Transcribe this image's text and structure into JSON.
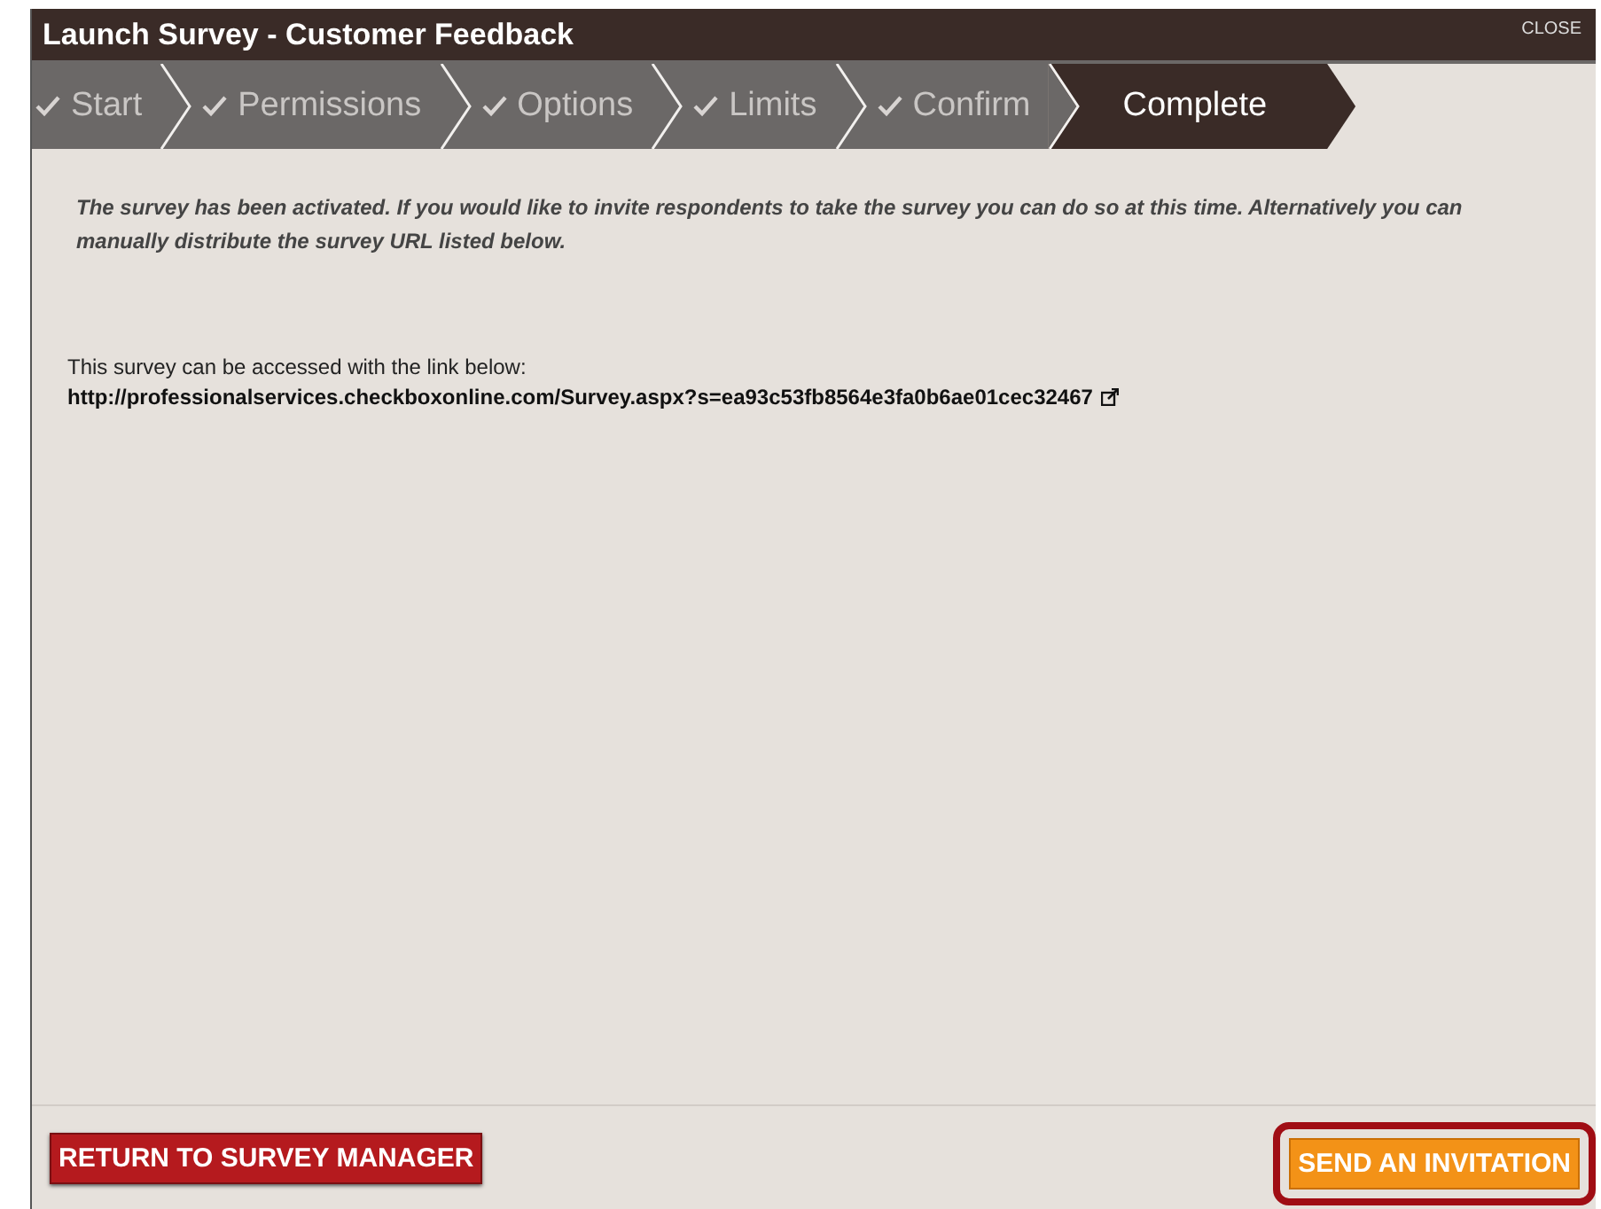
{
  "window": {
    "title": "Launch Survey - Customer Feedback",
    "close": "CLOSE"
  },
  "steps": [
    {
      "label": "Start",
      "completed": true,
      "selected": false
    },
    {
      "label": "Permissions",
      "completed": true,
      "selected": false
    },
    {
      "label": "Options",
      "completed": true,
      "selected": false
    },
    {
      "label": "Limits",
      "completed": true,
      "selected": false
    },
    {
      "label": "Confirm",
      "completed": true,
      "selected": false
    },
    {
      "label": "Complete",
      "completed": false,
      "selected": true
    }
  ],
  "message": "The survey has been activated. If you would like to invite respondents to take the survey you can do so at this time. Alternatively you can manually distribute the survey URL listed below.",
  "link_label": "This survey can be accessed with the link below:",
  "link_url": "http://professionalservices.checkboxonline.com/Survey.aspx?s=ea93c53fb8564e3fa0b6ae01cec32467",
  "buttons": {
    "return": "RETURN TO SURVEY MANAGER",
    "invite": "SEND AN INVITATION",
    "invite_highlighted": true
  }
}
